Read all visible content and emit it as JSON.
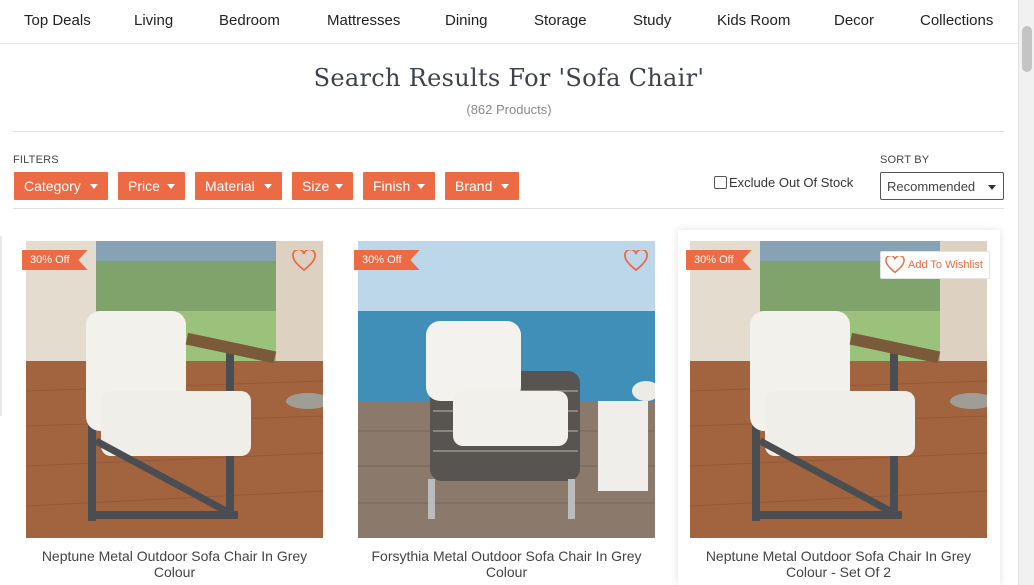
{
  "nav": [
    "Top Deals",
    "Living",
    "Bedroom",
    "Mattresses",
    "Dining",
    "Storage",
    "Study",
    "Kids Room",
    "Decor",
    "Collections"
  ],
  "search": {
    "title": "Search Results For 'Sofa Chair'",
    "count": "(862 Products)"
  },
  "filters": {
    "label": "FILTERS",
    "items": [
      "Category",
      "Price",
      "Material",
      "Size",
      "Finish",
      "Brand"
    ],
    "exclude_label": "Exclude Out Of Stock"
  },
  "sort": {
    "label": "SORT BY",
    "value": "Recommended"
  },
  "products": [
    {
      "name": "Neptune Metal Outdoor Sofa Chair In Grey Colour",
      "badge": "30% Off"
    },
    {
      "name": "Forsythia Metal Outdoor Sofa Chair In Grey Colour",
      "badge": "30% Off"
    },
    {
      "name": "Neptune Metal Outdoor Sofa Chair In Grey Colour - Set Of 2",
      "badge": "30% Off",
      "wishlist_label": "Add To Wishlist"
    }
  ],
  "colors": {
    "accent": "#ec6a44",
    "title": "#3d4150"
  },
  "icons": {
    "wishlist": "heart-outline-icon",
    "dropdown": "caret-down-icon"
  }
}
